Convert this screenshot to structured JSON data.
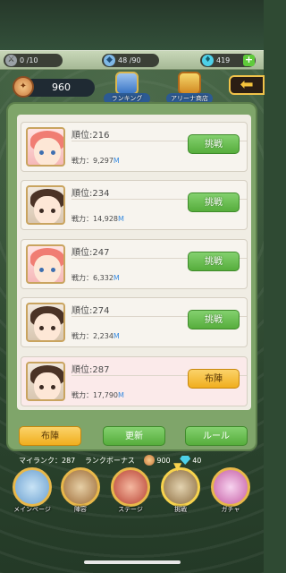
{
  "resources": {
    "stamina": "0 /10",
    "energy": "48 /90",
    "gems": "419",
    "plus_icon": "+"
  },
  "header": {
    "points": "960",
    "ranking_label": "ランキング",
    "shop_label": "アリーナ商店",
    "back_icon": "arrow-left"
  },
  "opponents": [
    {
      "rank": "順位:216",
      "power_label": "戦力：",
      "power": "9,297",
      "unit": "M",
      "action": "挑戦",
      "avatar": "pink"
    },
    {
      "rank": "順位:234",
      "power_label": "戦力：",
      "power": "14,928",
      "unit": "M",
      "action": "挑戦",
      "avatar": "dark"
    },
    {
      "rank": "順位:247",
      "power_label": "戦力：",
      "power": "6,332",
      "unit": "M",
      "action": "挑戦",
      "avatar": "pink"
    },
    {
      "rank": "順位:274",
      "power_label": "戦力：",
      "power": "2,234",
      "unit": "M",
      "action": "挑戦",
      "avatar": "dark"
    },
    {
      "rank": "順位:287",
      "power_label": "戦力：",
      "power": "17,790",
      "unit": "M",
      "action": "布陣",
      "avatar": "dark"
    }
  ],
  "buttons": {
    "formation": "布陣",
    "update": "更新",
    "rule": "ルール"
  },
  "info": {
    "my_rank": "マイランク：287",
    "bonus_label": "ランクボーナス",
    "bonus_points": "900",
    "bonus_gems": "40"
  },
  "nav": [
    {
      "label": "メインページ"
    },
    {
      "label": "陣容"
    },
    {
      "label": "ステージ"
    },
    {
      "label": "挑戦"
    },
    {
      "label": "ガチャ"
    }
  ]
}
